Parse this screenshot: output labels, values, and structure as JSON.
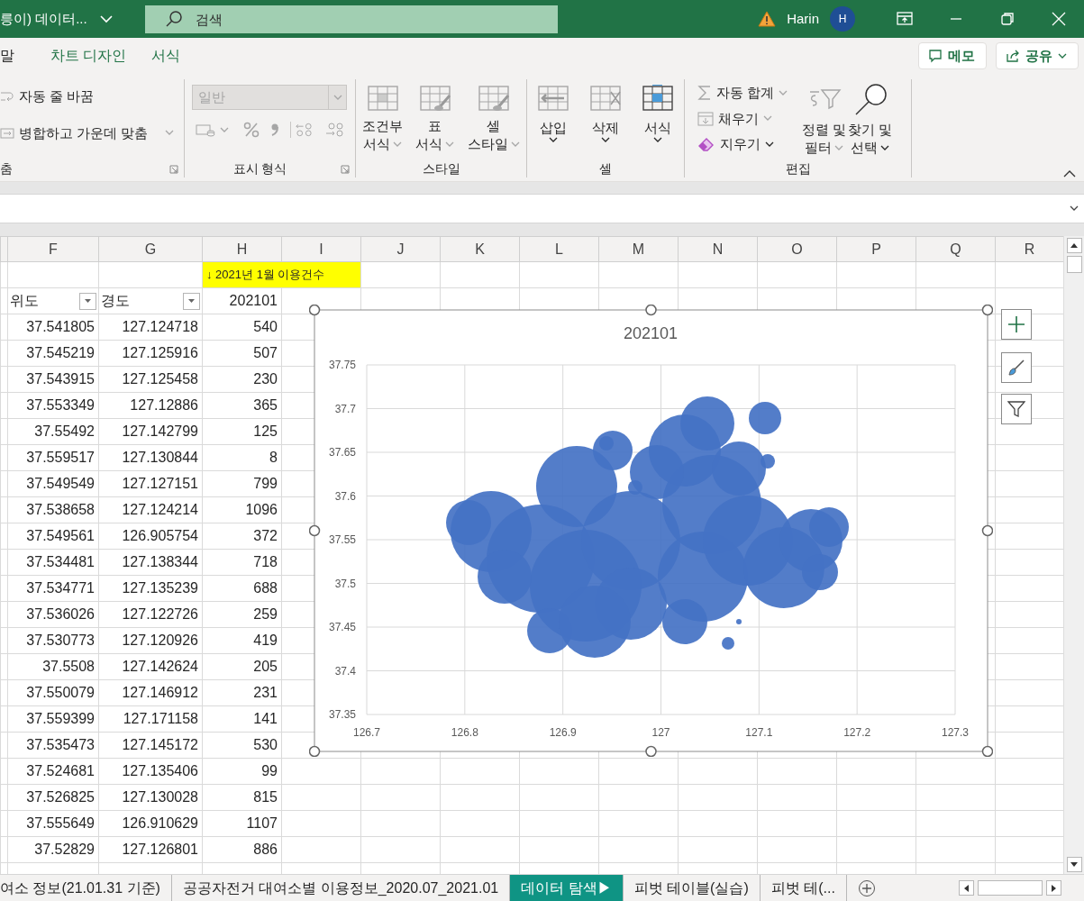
{
  "title_bar": {
    "document_title": "릉이) 데이터...",
    "search": {
      "placeholder": "검색"
    },
    "user_name": "Harin",
    "avatar_initial": "H"
  },
  "menu_tabs": [
    {
      "label": "말",
      "contextual": false
    },
    {
      "label": "차트 디자인",
      "contextual": true
    },
    {
      "label": "서식",
      "contextual": true
    }
  ],
  "header_buttons": [
    {
      "label": "메모"
    },
    {
      "label": "공유"
    }
  ],
  "ribbon": {
    "alignment": {
      "label": "춤",
      "items": [
        {
          "label": "자동 줄 바꿈",
          "disabled": true
        },
        {
          "label": "병합하고 가운데 맞춤",
          "disabled": true
        }
      ]
    },
    "number": {
      "label": "표시 형식",
      "format_value": "일반",
      "disabled": true
    },
    "styles": {
      "label": "스타일",
      "items": [
        {
          "lines": [
            "조건부",
            "서식"
          ],
          "disabled": true
        },
        {
          "lines": [
            "표",
            "서식"
          ],
          "disabled": true
        },
        {
          "lines": [
            "셀",
            "스타일"
          ],
          "disabled": true
        }
      ]
    },
    "cells": {
      "label": "셀",
      "items": [
        {
          "label": "삽입",
          "disabled": false
        },
        {
          "label": "삭제",
          "disabled": false
        },
        {
          "label": "서식",
          "disabled": false
        }
      ]
    },
    "editing": {
      "label": "편집",
      "small_items": [
        {
          "label": "자동 합계",
          "disabled": true
        },
        {
          "label": "채우기",
          "disabled": true
        },
        {
          "label": "지우기",
          "disabled": false
        }
      ],
      "large_items": [
        {
          "lines": [
            "정렬 및",
            "필터"
          ],
          "disabled": true
        },
        {
          "lines": [
            "찾기 및",
            "선택"
          ],
          "disabled": false
        }
      ]
    }
  },
  "column_headers": [
    "F",
    "G",
    "H",
    "I",
    "J",
    "K",
    "L",
    "M",
    "N",
    "O",
    "P",
    "Q",
    "R"
  ],
  "note": "↓ 2021년 1월 이용건수",
  "table": {
    "columns": [
      "위도",
      "경도",
      "202101"
    ],
    "rows": [
      [
        "37.541805",
        "127.124718",
        "540"
      ],
      [
        "37.545219",
        "127.125916",
        "507"
      ],
      [
        "37.543915",
        "127.125458",
        "230"
      ],
      [
        "37.553349",
        "127.12886",
        "365"
      ],
      [
        "37.55492",
        "127.142799",
        "125"
      ],
      [
        "37.559517",
        "127.130844",
        "8"
      ],
      [
        "37.549549",
        "127.127151",
        "799"
      ],
      [
        "37.538658",
        "127.124214",
        "1096"
      ],
      [
        "37.549561",
        "126.905754",
        "372"
      ],
      [
        "37.534481",
        "127.138344",
        "718"
      ],
      [
        "37.534771",
        "127.135239",
        "688"
      ],
      [
        "37.536026",
        "127.122726",
        "259"
      ],
      [
        "37.530773",
        "127.120926",
        "419"
      ],
      [
        "37.5508",
        "127.142624",
        "205"
      ],
      [
        "37.550079",
        "127.146912",
        "231"
      ],
      [
        "37.559399",
        "127.171158",
        "141"
      ],
      [
        "37.535473",
        "127.145172",
        "530"
      ],
      [
        "37.524681",
        "127.135406",
        "99"
      ],
      [
        "37.526825",
        "127.130028",
        "815"
      ],
      [
        "37.555649",
        "126.910629",
        "1107"
      ],
      [
        "37.52829",
        "127.126801",
        "886"
      ]
    ]
  },
  "chart": {
    "title": "202101",
    "xticks": [
      "126.7",
      "126.8",
      "126.9",
      "127",
      "127.1",
      "127.2",
      "127.3"
    ],
    "yticks": [
      "37.75",
      "37.7",
      "37.65",
      "37.6",
      "37.55",
      "37.5",
      "37.45",
      "37.4",
      "37.35"
    ]
  },
  "sheet_tabs": [
    {
      "label": "여소 정보(21.01.31 기준)",
      "selected": false
    },
    {
      "label": "공공자전거 대여소별 이용정보_2020.07_2021.01",
      "selected": false
    },
    {
      "label": "데이터 탐색▶",
      "selected": true
    },
    {
      "label": "피벗 테이블(실습)",
      "selected": false
    },
    {
      "label": "피벗 테(...",
      "selected": false
    }
  ]
}
